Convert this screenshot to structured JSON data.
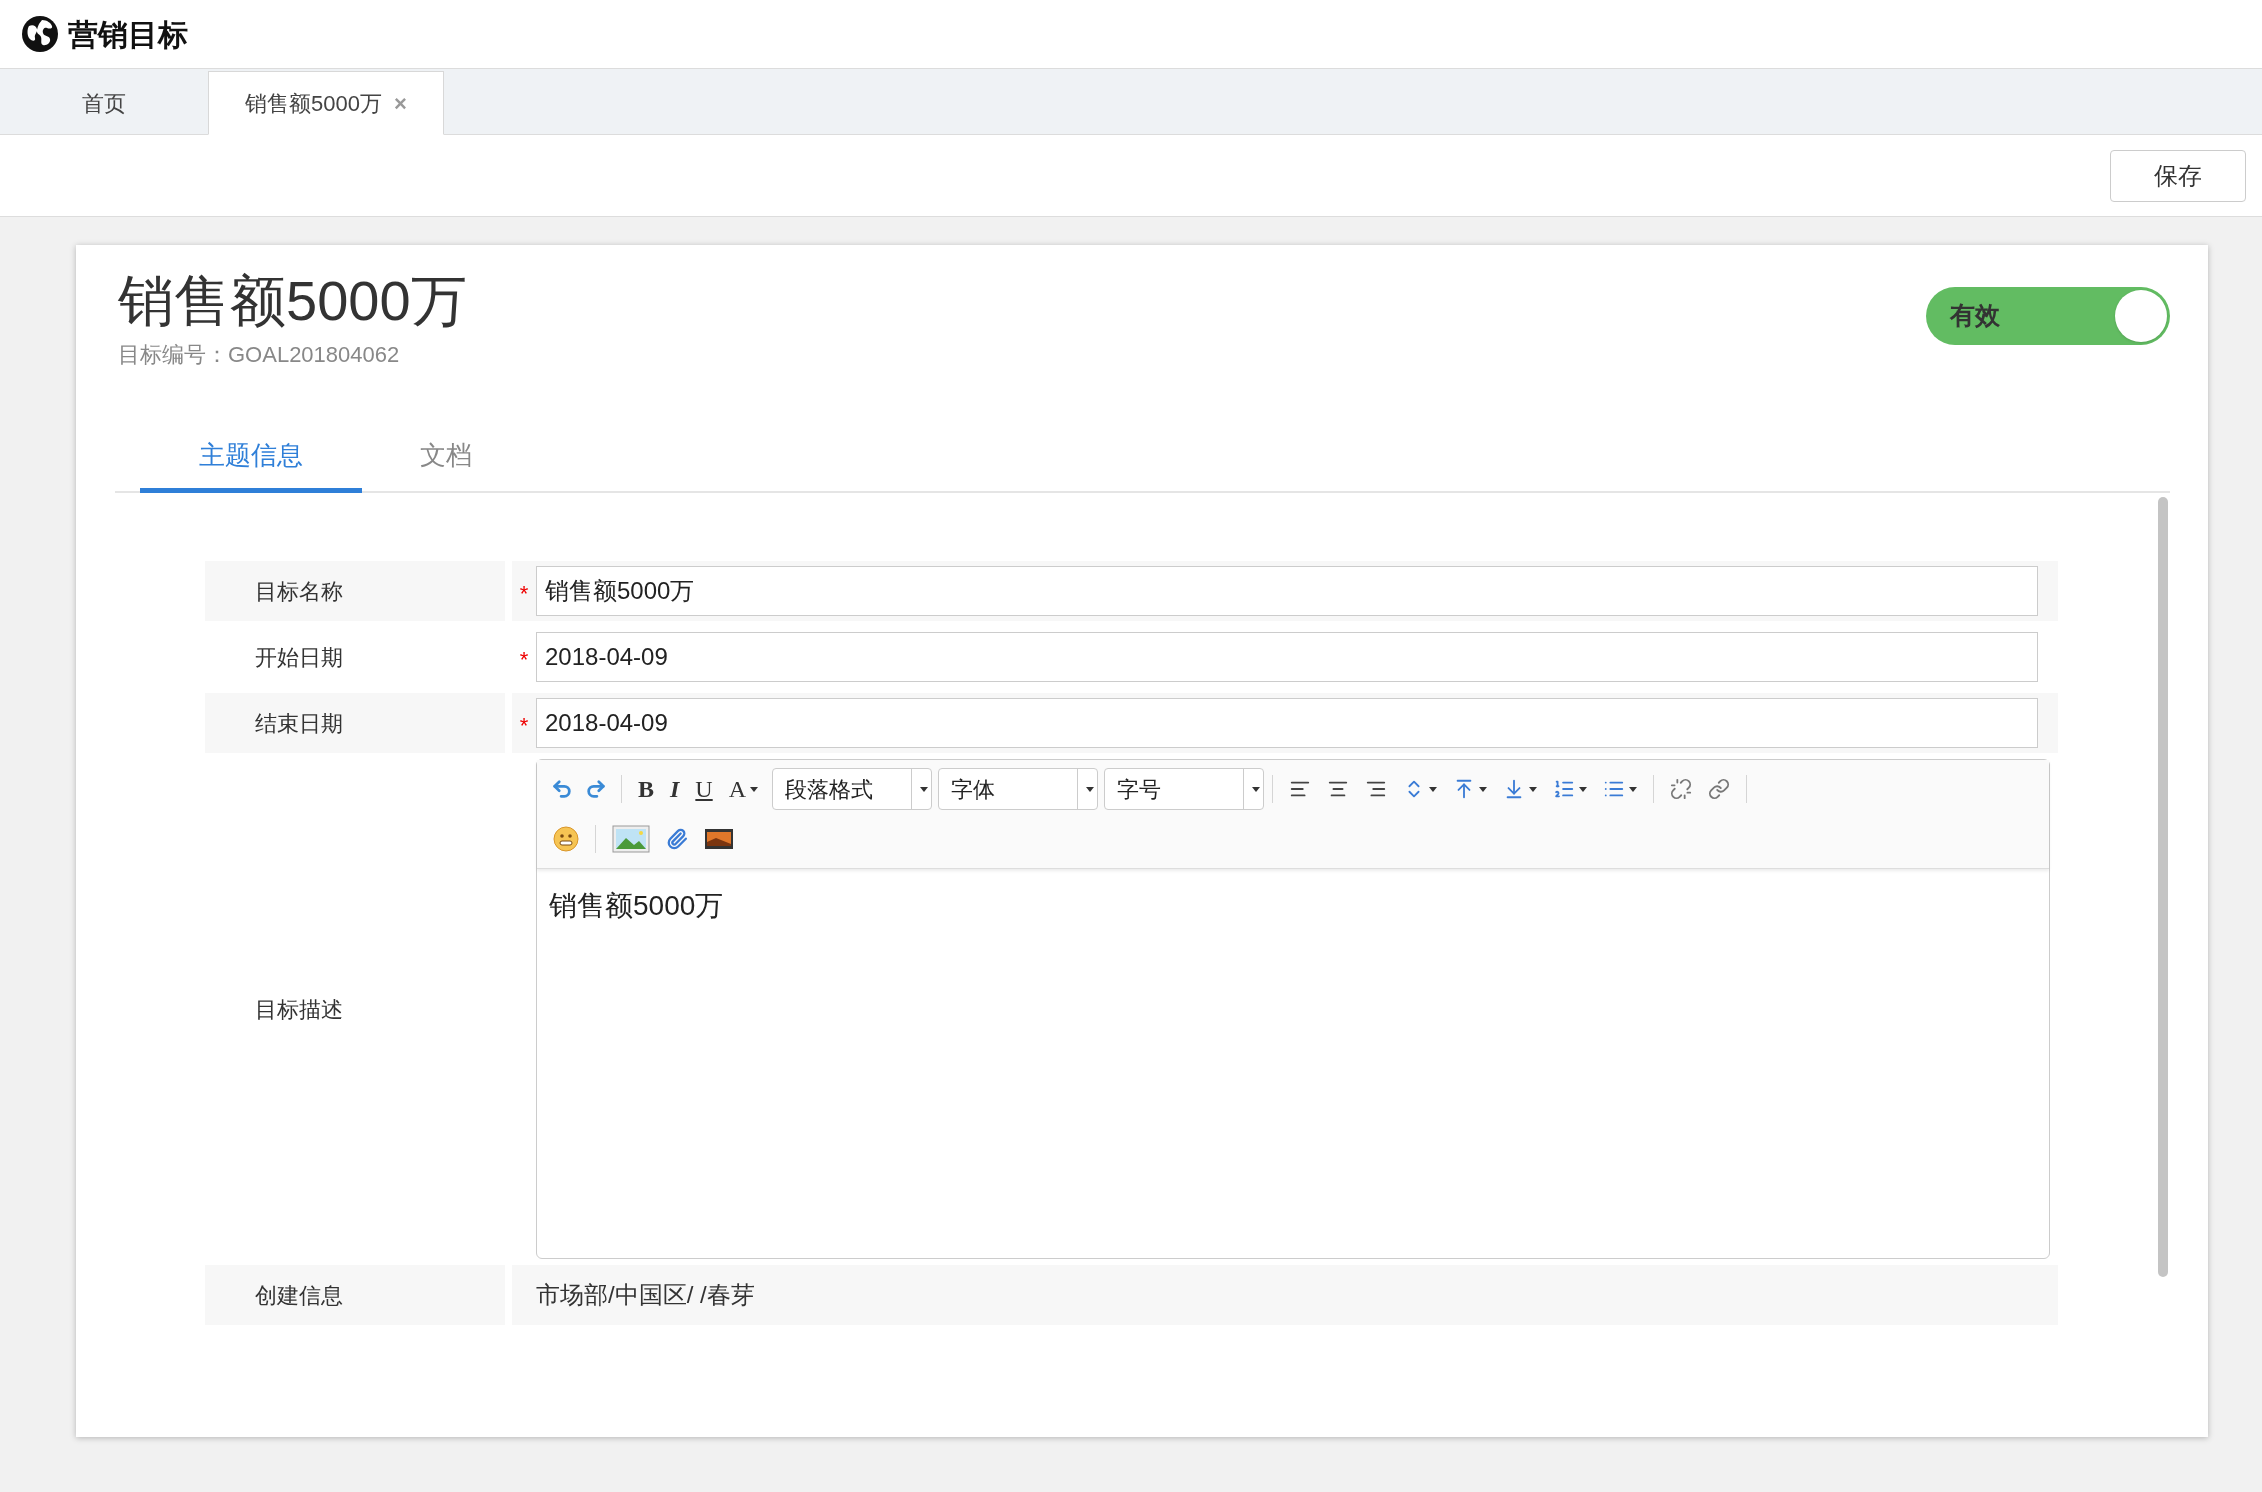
{
  "app": {
    "title": "营销目标"
  },
  "page_tabs": [
    {
      "label": "首页",
      "selected": false
    },
    {
      "label": "销售额5000万",
      "selected": true,
      "close": "×"
    }
  ],
  "actions": {
    "save": "保存"
  },
  "goal": {
    "title": "销售额5000万",
    "code_label": "目标编号：",
    "code": "GOAL201804062",
    "status": {
      "label": "有效",
      "on": true
    }
  },
  "detail_tabs": [
    {
      "label": "主题信息",
      "selected": true
    },
    {
      "label": "文档",
      "selected": false
    }
  ],
  "form": [
    {
      "kind": "input",
      "label": "目标名称",
      "required_mark": "*",
      "value": "销售额5000万"
    },
    {
      "kind": "input",
      "label": "开始日期",
      "required_mark": "*",
      "value": "2018-04-09"
    },
    {
      "kind": "input",
      "label": "结束日期",
      "required_mark": "*",
      "value": "2018-04-09"
    },
    {
      "kind": "editor",
      "label": "目标描述",
      "value": "销售额5000万"
    },
    {
      "kind": "text",
      "label": "创建信息",
      "value": "市场部/中国区/ /春芽"
    }
  ],
  "editor_toolbar": [
    [
      {
        "kind": "undo"
      },
      {
        "kind": "redo"
      },
      {
        "kind": "sep"
      },
      {
        "kind": "bold",
        "label": "B"
      },
      {
        "kind": "italic",
        "label": "I"
      },
      {
        "kind": "underline",
        "label": "U"
      },
      {
        "kind": "color",
        "label": "A"
      },
      {
        "kind": "select",
        "label": "段落格式"
      },
      {
        "kind": "select",
        "label": "字体"
      },
      {
        "kind": "select",
        "label": "字号"
      },
      {
        "kind": "sep"
      },
      {
        "kind": "align-left"
      },
      {
        "kind": "align-center"
      },
      {
        "kind": "align-right"
      },
      {
        "kind": "line-height"
      },
      {
        "kind": "space-before"
      },
      {
        "kind": "space-after"
      },
      {
        "kind": "ordered-list"
      },
      {
        "kind": "bullet-list"
      },
      {
        "kind": "sep"
      },
      {
        "kind": "unlink"
      },
      {
        "kind": "link"
      },
      {
        "kind": "sep"
      }
    ],
    [
      {
        "kind": "emoji"
      },
      {
        "kind": "sep"
      },
      {
        "kind": "image"
      },
      {
        "kind": "attachment"
      },
      {
        "kind": "video"
      }
    ]
  ]
}
